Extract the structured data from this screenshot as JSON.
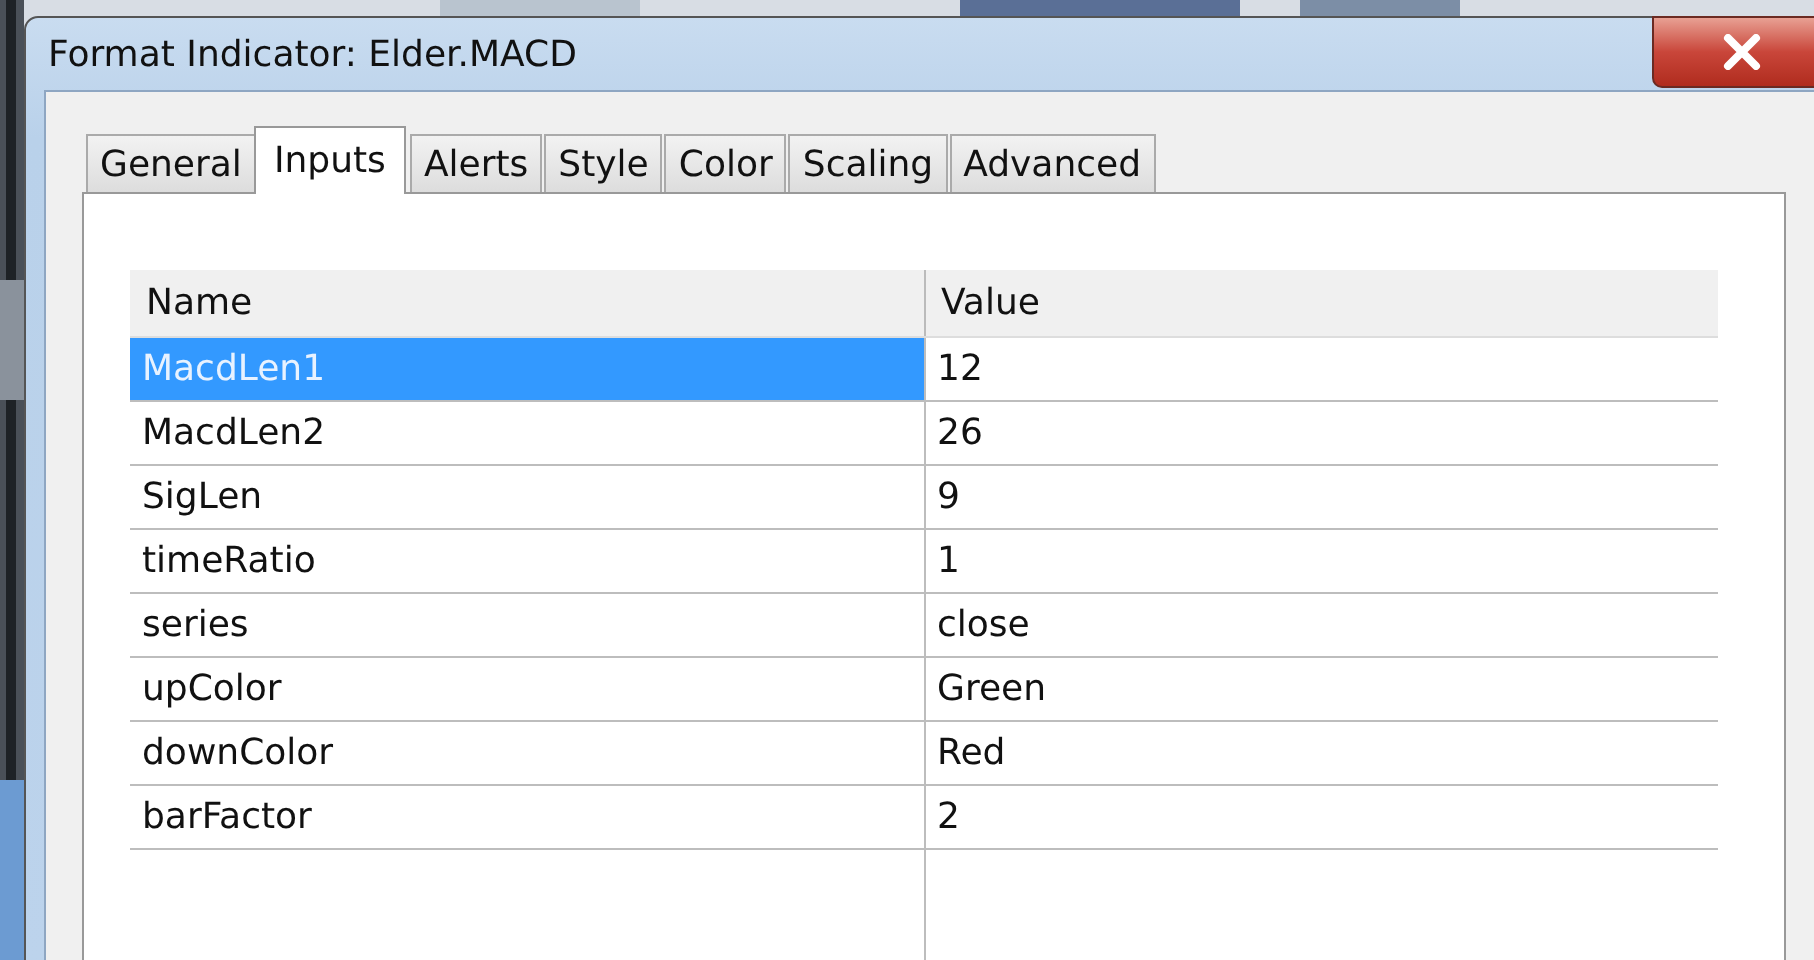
{
  "window": {
    "title": "Format Indicator: Elder.MACD"
  },
  "tabs": [
    {
      "label": "General",
      "selected": false
    },
    {
      "label": "Inputs",
      "selected": true
    },
    {
      "label": "Alerts",
      "selected": false
    },
    {
      "label": "Style",
      "selected": false
    },
    {
      "label": "Color",
      "selected": false
    },
    {
      "label": "Scaling",
      "selected": false
    },
    {
      "label": "Advanced",
      "selected": false
    }
  ],
  "table": {
    "columns": [
      "Name",
      "Value"
    ],
    "rows": [
      {
        "name": "MacdLen1",
        "value": "12",
        "selected": true
      },
      {
        "name": "MacdLen2",
        "value": "26",
        "selected": false
      },
      {
        "name": "SigLen",
        "value": "9",
        "selected": false
      },
      {
        "name": "timeRatio",
        "value": "1",
        "selected": false
      },
      {
        "name": "series",
        "value": "close",
        "selected": false
      },
      {
        "name": "upColor",
        "value": "Green",
        "selected": false
      },
      {
        "name": "downColor",
        "value": "Red",
        "selected": false
      },
      {
        "name": "barFactor",
        "value": "2",
        "selected": false
      }
    ]
  }
}
